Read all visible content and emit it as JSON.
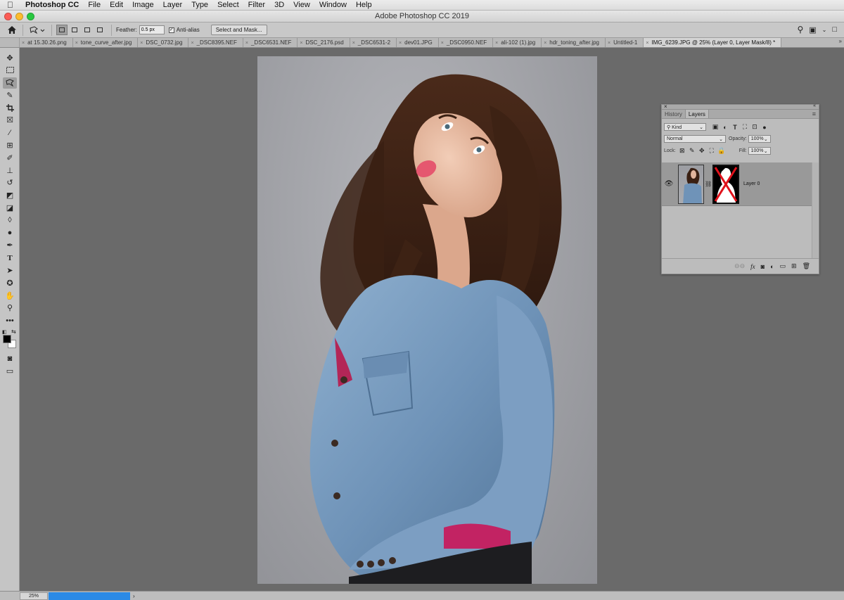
{
  "menubar": {
    "apple": "",
    "items": [
      "Photoshop CC",
      "File",
      "Edit",
      "Image",
      "Layer",
      "Type",
      "Select",
      "Filter",
      "3D",
      "View",
      "Window",
      "Help"
    ]
  },
  "titlebar": {
    "title": "Adobe Photoshop CC 2019"
  },
  "options": {
    "feather_label": "Feather:",
    "feather_value": "0.5 px",
    "antialias_label": "Anti-alias",
    "select_mask_label": "Select and Mask..."
  },
  "tabs": [
    {
      "label": "at 15.30.26.png"
    },
    {
      "label": "tone_curve_after.jpg"
    },
    {
      "label": "DSC_0732.jpg"
    },
    {
      "label": "_DSC8395.NEF"
    },
    {
      "label": "_DSC6531.NEF"
    },
    {
      "label": "DSC_2176.psd"
    },
    {
      "label": "_DSC6531-2"
    },
    {
      "label": "dev01.JPG"
    },
    {
      "label": "_DSC0950.NEF"
    },
    {
      "label": "ali-102 (1).jpg"
    },
    {
      "label": "hdr_toning_after.jpg"
    },
    {
      "label": "Untitled-1"
    },
    {
      "label": "IMG_6239.JPG @ 25% (Layer 0, Layer Mask/8) *"
    }
  ],
  "layers_panel": {
    "tabs": [
      "History",
      "Layers"
    ],
    "kind_label": "Kind",
    "blend_mode": "Normal",
    "opacity_label": "Opacity:",
    "opacity_value": "100%",
    "lock_label": "Lock:",
    "fill_label": "Fill:",
    "fill_value": "100%",
    "layer_name": "Layer 0"
  },
  "status": {
    "zoom": "25%"
  },
  "colors": {
    "foreground": "#000000",
    "background": "#ffffff",
    "progress": "#2b8ae6",
    "mask_red": "#e0121b"
  }
}
